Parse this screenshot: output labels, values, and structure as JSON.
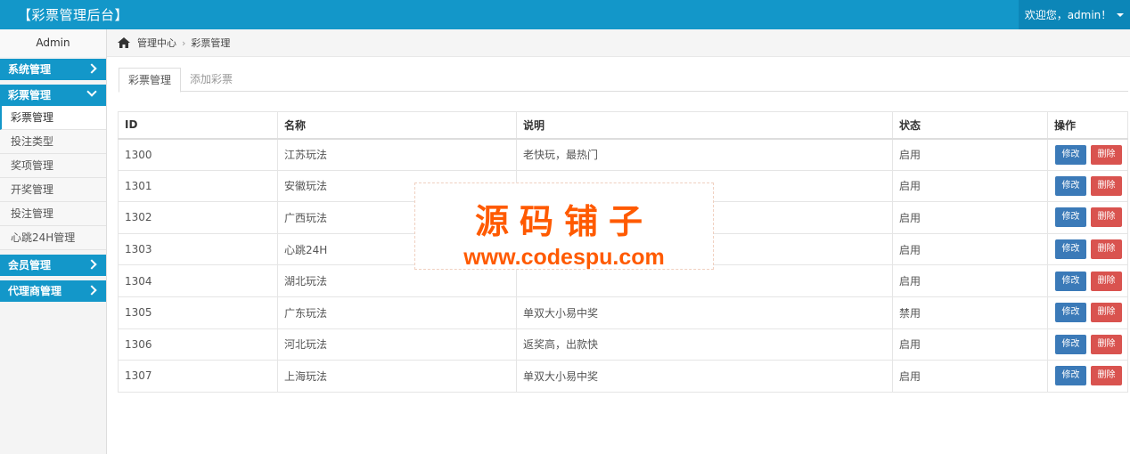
{
  "header": {
    "title": "【彩票管理后台】",
    "user_greeting": "欢迎您，admin！"
  },
  "sidebar": {
    "user": "Admin",
    "groups": [
      {
        "label": "系统管理"
      },
      {
        "label": "彩票管理",
        "items": [
          "彩票管理",
          "投注类型",
          "奖项管理",
          "开奖管理",
          "投注管理",
          "心跳24H管理"
        ]
      },
      {
        "label": "会员管理"
      },
      {
        "label": "代理商管理"
      }
    ]
  },
  "breadcrumb": {
    "home": "管理中心",
    "current": "彩票管理"
  },
  "tabs": [
    "彩票管理",
    "添加彩票"
  ],
  "table": {
    "headers": [
      "ID",
      "名称",
      "说明",
      "状态",
      "操作"
    ],
    "rows": [
      {
        "id": "1300",
        "name": "江苏玩法",
        "desc": "老快玩，最热门",
        "status": "启用"
      },
      {
        "id": "1301",
        "name": "安徽玩法",
        "desc": "",
        "status": "启用"
      },
      {
        "id": "1302",
        "name": "广西玩法",
        "desc": "",
        "status": "启用"
      },
      {
        "id": "1303",
        "name": "心跳24H",
        "desc": "",
        "status": "启用"
      },
      {
        "id": "1304",
        "name": "湖北玩法",
        "desc": "",
        "status": "启用"
      },
      {
        "id": "1305",
        "name": "广东玩法",
        "desc": "单双大小易中奖",
        "status": "禁用"
      },
      {
        "id": "1306",
        "name": "河北玩法",
        "desc": "返奖高，出款快",
        "status": "启用"
      },
      {
        "id": "1307",
        "name": "上海玩法",
        "desc": "单双大小易中奖",
        "status": "启用"
      }
    ],
    "edit_label": "修改",
    "delete_label": "删除"
  },
  "watermark": {
    "title": "源码铺子",
    "url": "www.codespu.com"
  },
  "colors": {
    "primary": "#1397c9",
    "edit_button": "#3b7ab8",
    "delete_button": "#d9534f",
    "watermark": "#ff5a00"
  }
}
